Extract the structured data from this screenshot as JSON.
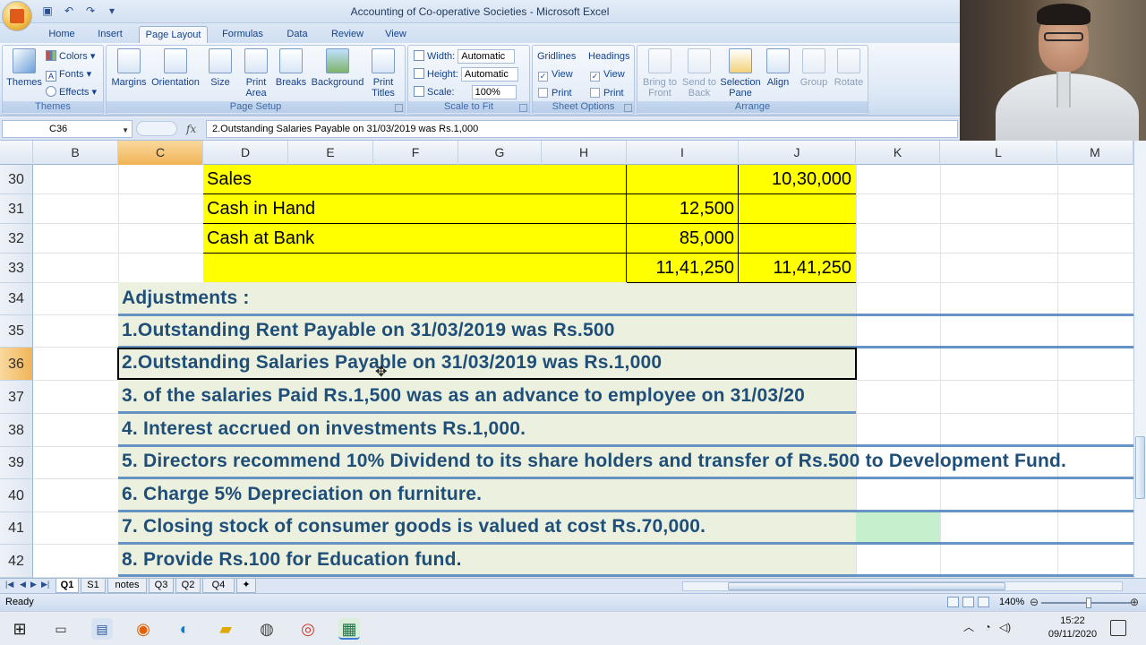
{
  "window": {
    "title": "Accounting of Co-operative Societies - Microsoft Excel"
  },
  "ribbon": {
    "tabs": [
      "Home",
      "Insert",
      "Page Layout",
      "Formulas",
      "Data",
      "Review",
      "View"
    ],
    "active_tab": "Page Layout",
    "themes": {
      "group_label": "Themes",
      "themes_label": "Themes",
      "colors_label": "Colors",
      "fonts_label": "Fonts",
      "effects_label": "Effects"
    },
    "page_setup": {
      "group_label": "Page Setup",
      "margins": "Margins",
      "orientation": "Orientation",
      "size": "Size",
      "print_area": "Print Area",
      "breaks": "Breaks",
      "background": "Background",
      "print_titles": "Print Titles"
    },
    "scale_to_fit": {
      "group_label": "Scale to Fit",
      "width_label": "Width:",
      "width_value": "Automatic",
      "height_label": "Height:",
      "height_value": "Automatic",
      "scale_label": "Scale:",
      "scale_value": "100%"
    },
    "sheet_options": {
      "group_label": "Sheet Options",
      "gridlines": "Gridlines",
      "headings": "Headings",
      "view": "View",
      "print": "Print"
    },
    "arrange": {
      "group_label": "Arrange",
      "bring_to_front": "Bring to Front",
      "send_to_back": "Send to Back",
      "selection_pane": "Selection Pane",
      "align": "Align",
      "group": "Group",
      "rotate": "Rotate"
    }
  },
  "formula_bar": {
    "name_box": "C36",
    "fx": "fx",
    "formula": "2.Outstanding Salaries Payable on 31/03/2019 was Rs.1,000"
  },
  "columns": [
    "B",
    "C",
    "D",
    "E",
    "F",
    "G",
    "H",
    "I",
    "J",
    "K",
    "L",
    "M"
  ],
  "rows": [
    "30",
    "31",
    "32",
    "33",
    "34",
    "35",
    "36",
    "37",
    "38",
    "39",
    "40",
    "41",
    "42"
  ],
  "table": {
    "r30": {
      "label": "Sales",
      "i": "",
      "j": "10,30,000"
    },
    "r31": {
      "label": "Cash in Hand",
      "i": "12,500",
      "j": ""
    },
    "r32": {
      "label": "Cash at Bank",
      "i": "85,000",
      "j": ""
    },
    "r33": {
      "label": "",
      "i": "11,41,250",
      "j": "11,41,250"
    }
  },
  "adjustments": {
    "heading": "Adjustments :",
    "items": [
      "1.Outstanding Rent Payable on 31/03/2019 was Rs.500",
      "2.Outstanding Salaries Payable on 31/03/2019 was Rs.1,000",
      "3. of the salaries Paid Rs.1,500 was as an advance to employee on 31/03/20",
      "4. Interest accrued on investments Rs.1,000.",
      "5. Directors recommend 10% Dividend to its share holders and transfer of Rs.500 to Development Fund.",
      "6. Charge 5% Depreciation on furniture.",
      "7. Closing stock of consumer goods is valued at cost Rs.70,000.",
      "8. Provide Rs.100 for Education fund."
    ]
  },
  "sheets": [
    "Q1",
    "S1",
    "notes",
    "Q3",
    "Q2",
    "Q4"
  ],
  "active_sheet": "Q1",
  "status": {
    "ready": "Ready",
    "zoom": "140%"
  },
  "taskbar": {
    "time": "15:22",
    "date": "09/11/2020"
  },
  "colors": {
    "highlight": "#ffff00",
    "adjustment_text": "#1f4e79",
    "adjustment_bg": "#ebf1de",
    "selected_header": "#f1b456"
  }
}
